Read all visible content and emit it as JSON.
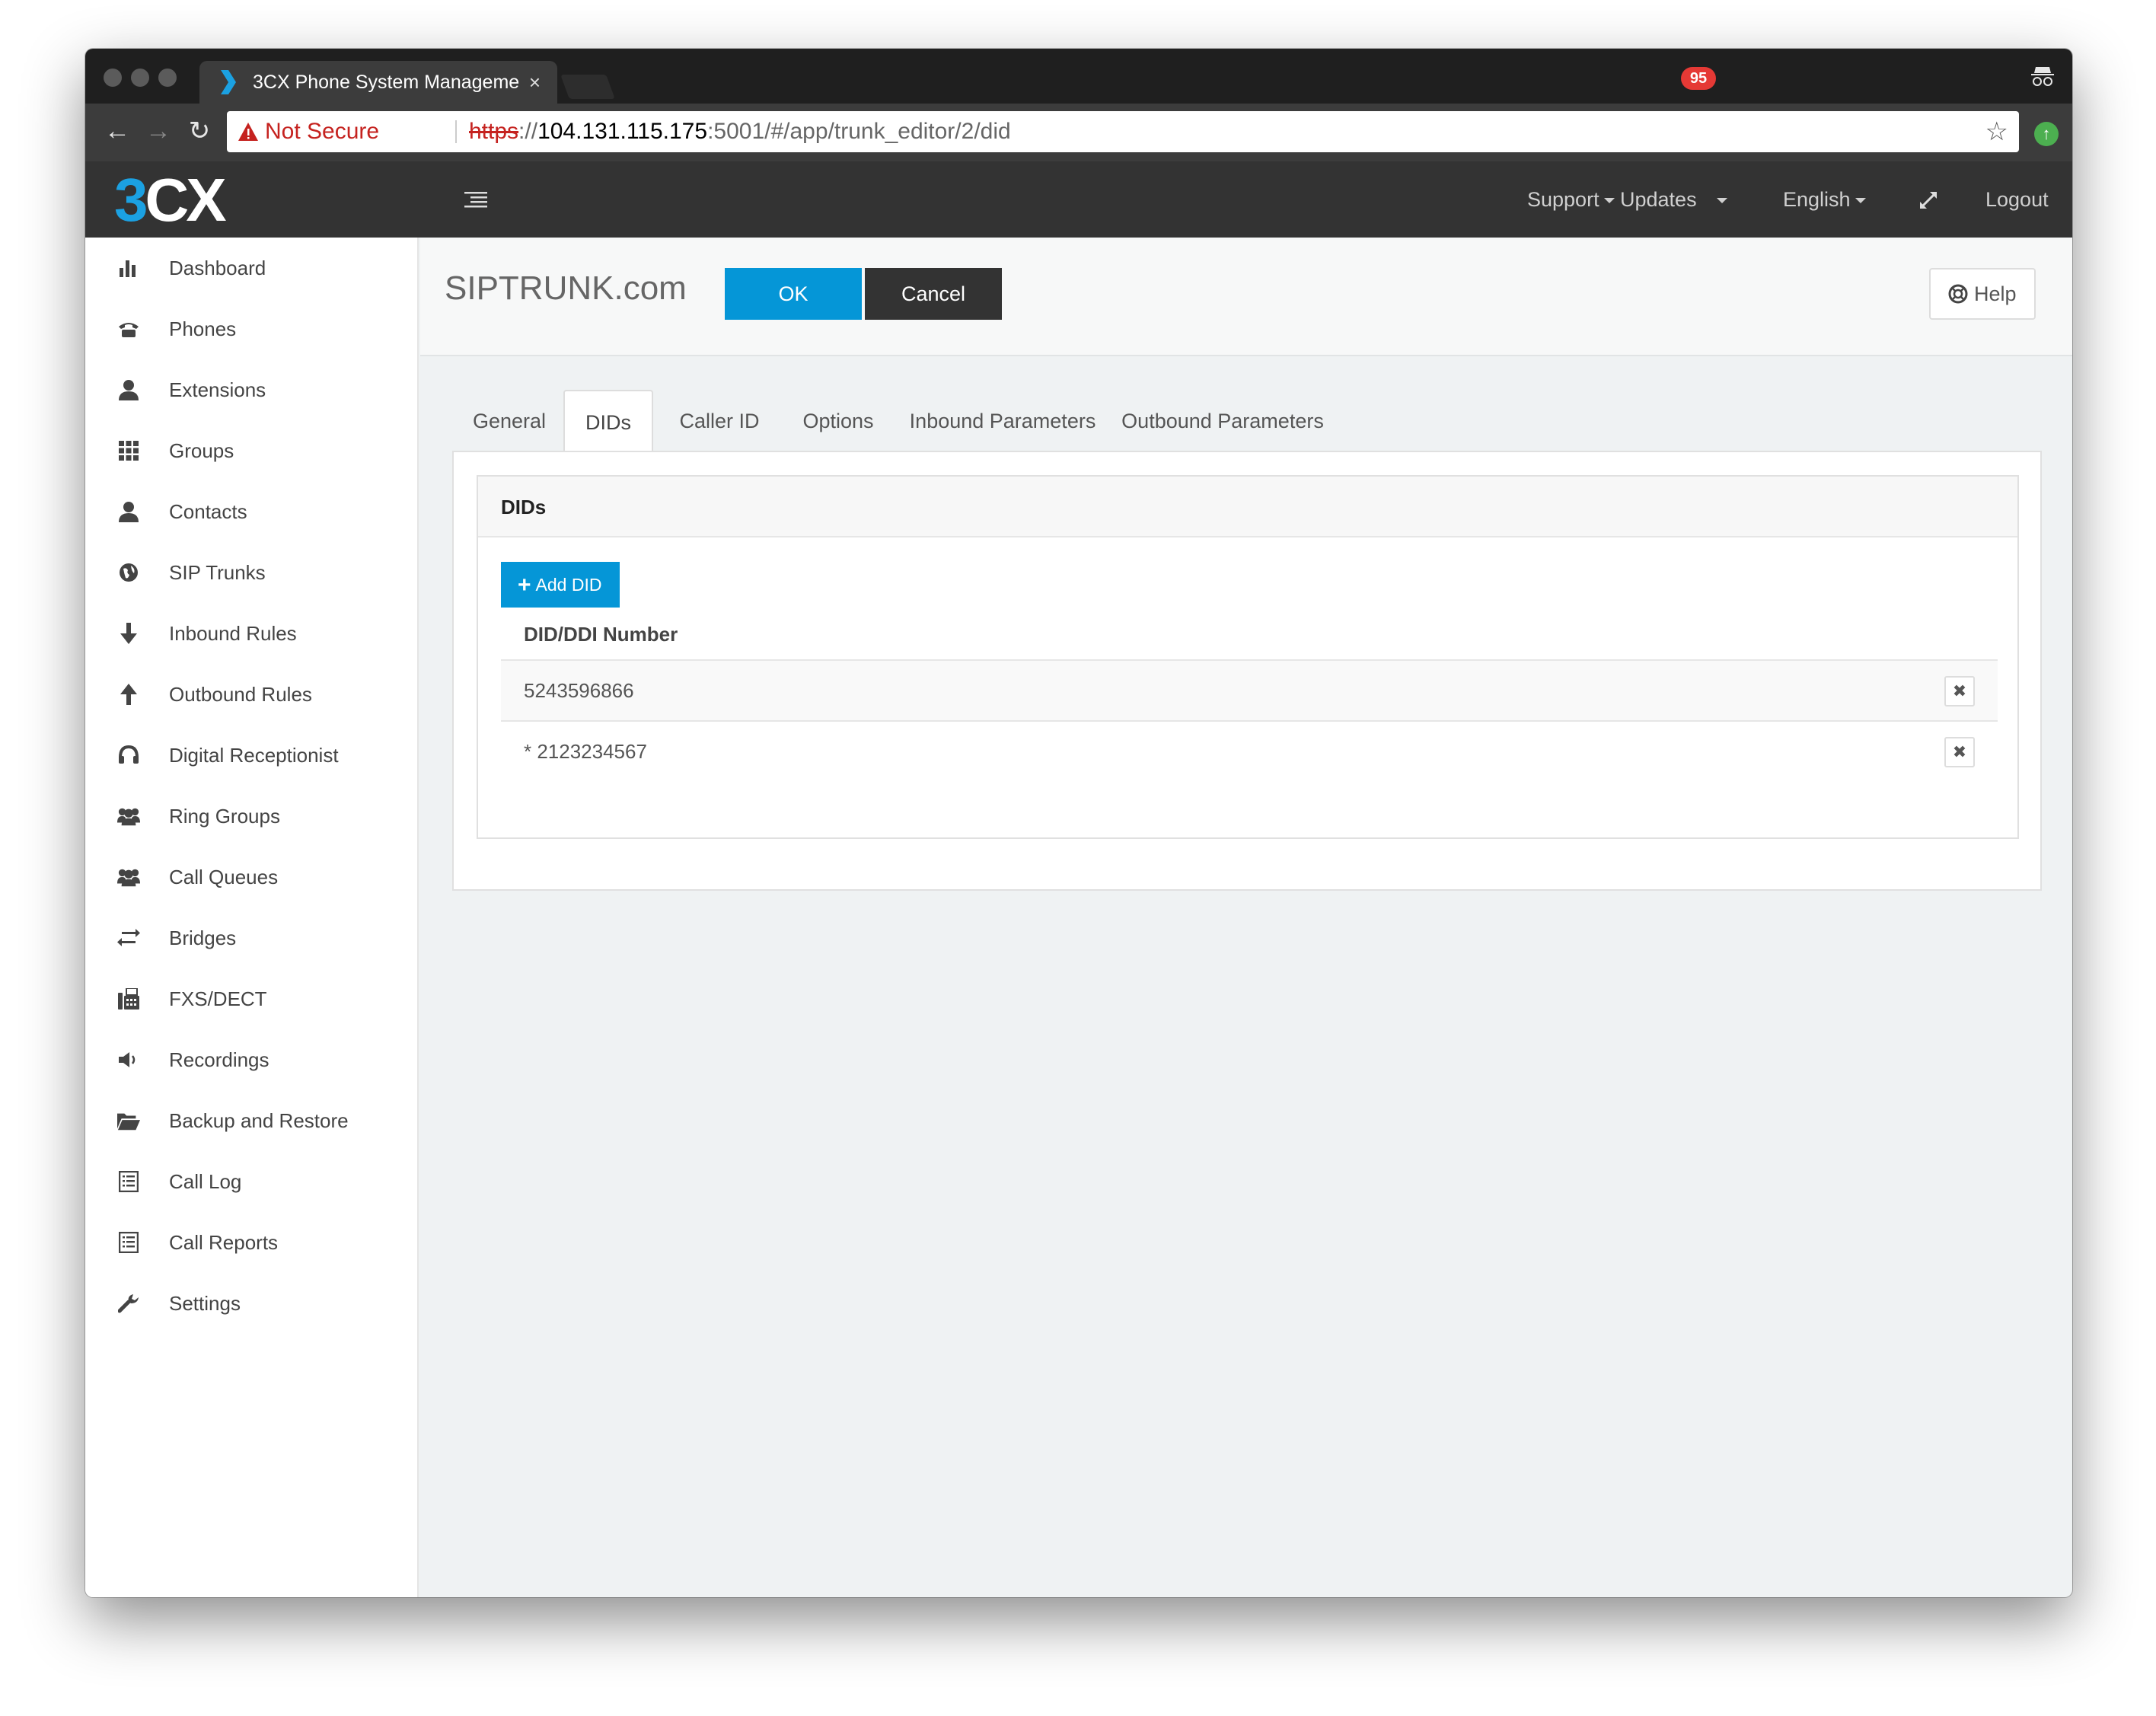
{
  "browser": {
    "tab_title": "3CX Phone System Manageme",
    "tab_close": "×",
    "security_label": "Not Secure",
    "url_scheme": "https",
    "url_sep": "://",
    "url_host": "104.131.115.175",
    "url_path": ":5001/#/app/trunk_editor/2/did"
  },
  "header": {
    "logo_3": "3",
    "logo_cx": "CX",
    "support": "Support",
    "updates": "Updates",
    "updates_badge": "95",
    "language": "English",
    "logout": "Logout"
  },
  "sidebar": {
    "items": [
      {
        "label": "Dashboard",
        "icon": "bar-chart-icon"
      },
      {
        "label": "Phones",
        "icon": "phone-icon"
      },
      {
        "label": "Extensions",
        "icon": "user-icon"
      },
      {
        "label": "Groups",
        "icon": "grid-icon"
      },
      {
        "label": "Contacts",
        "icon": "user-icon"
      },
      {
        "label": "SIP Trunks",
        "icon": "globe-icon"
      },
      {
        "label": "Inbound Rules",
        "icon": "arrow-down-icon"
      },
      {
        "label": "Outbound Rules",
        "icon": "arrow-up-icon"
      },
      {
        "label": "Digital Receptionist",
        "icon": "headset-icon"
      },
      {
        "label": "Ring Groups",
        "icon": "users-icon"
      },
      {
        "label": "Call Queues",
        "icon": "users-icon"
      },
      {
        "label": "Bridges",
        "icon": "exchange-icon"
      },
      {
        "label": "FXS/DECT",
        "icon": "fax-icon"
      },
      {
        "label": "Recordings",
        "icon": "volume-icon"
      },
      {
        "label": "Backup and Restore",
        "icon": "folder-open-icon"
      },
      {
        "label": "Call Log",
        "icon": "list-icon"
      },
      {
        "label": "Call Reports",
        "icon": "list-icon"
      },
      {
        "label": "Settings",
        "icon": "wrench-icon"
      }
    ]
  },
  "page": {
    "title": "SIPTRUNK.com",
    "ok": "OK",
    "cancel": "Cancel",
    "help": "Help"
  },
  "tabs": [
    "General",
    "DIDs",
    "Caller ID",
    "Options",
    "Inbound Parameters",
    "Outbound Parameters"
  ],
  "active_tab": "DIDs",
  "dids_panel": {
    "title": "DIDs",
    "add_button": "Add DID",
    "column_header": "DID/DDI Number",
    "rows": [
      "5243596866",
      "* 2123234567"
    ],
    "delete_glyph": "✖"
  },
  "colors": {
    "accent": "#0596d7",
    "header_bg": "#333333",
    "badge": "#e53935",
    "not_secure": "#c5221f"
  }
}
